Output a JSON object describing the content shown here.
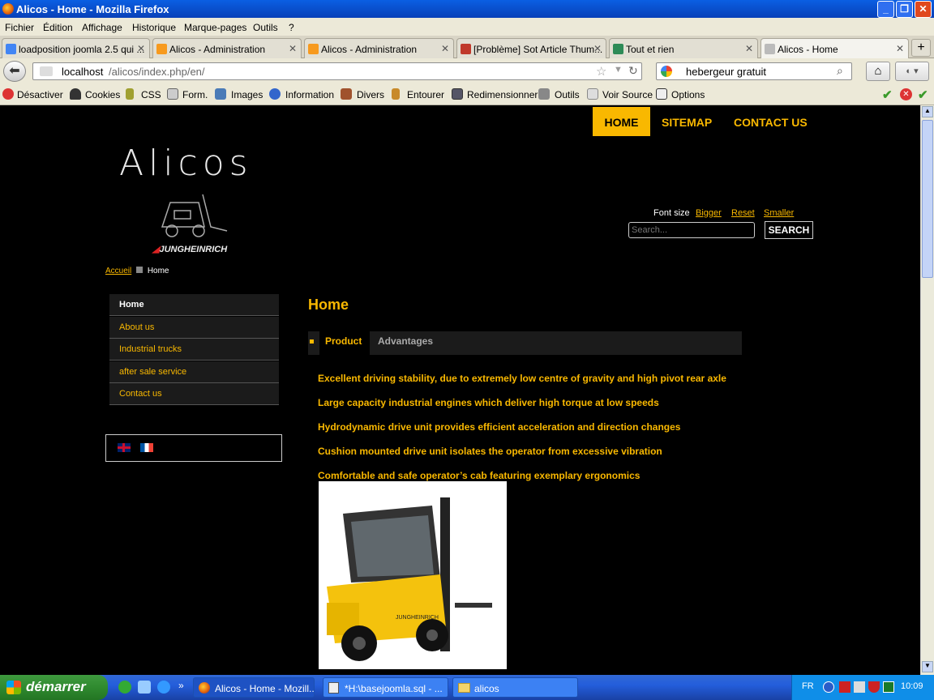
{
  "window": {
    "title": "Alicos - Home - Mozilla Firefox"
  },
  "menubar": [
    "Fichier",
    "Édition",
    "Affichage",
    "Historique",
    "Marque-pages",
    "Outils",
    "?"
  ],
  "tabs": [
    {
      "label": "loadposition joomla 2.5 qui ..."
    },
    {
      "label": "Alicos - Administration"
    },
    {
      "label": "Alicos - Administration"
    },
    {
      "label": "[Problème] Sot Article Thum..."
    },
    {
      "label": "Tout et rien"
    },
    {
      "label": "Alicos - Home"
    }
  ],
  "nav": {
    "url_host": "localhost",
    "url_path": "/alicos/index.php/en/",
    "search_value": "hebergeur gratuit"
  },
  "webdev": [
    "Désactiver",
    "Cookies",
    "CSS",
    "Form.",
    "Images",
    "Information",
    "Divers",
    "Entourer",
    "Redimensionner",
    "Outils",
    "Voir Source",
    "Options"
  ],
  "site": {
    "topnav": [
      "HOME",
      "SITEMAP",
      "CONTACT US"
    ],
    "logo_text": "Alicos",
    "brand": "JUNGHEINRICH",
    "fontsize": {
      "label": "Font size",
      "bigger": "Bigger",
      "reset": "Reset",
      "smaller": "Smaller"
    },
    "search": {
      "placeholder": "Search...",
      "button": "SEARCH"
    },
    "breadcrumb": {
      "home": "Accueil",
      "current": "Home"
    },
    "sidemenu": [
      "Home",
      "About us",
      "Industrial trucks",
      "after sale service",
      "Contact us"
    ],
    "page_title": "Home",
    "content_tabs": [
      "Product",
      "Advantages"
    ],
    "features": [
      "Excellent driving stability, due to extremely low centre of gravity and high pivot rear axle",
      "Large capacity industrial engines which deliver high torque at low speeds",
      "Hydrodynamic drive unit provides efficient acceleration and direction changes",
      "Cushion mounted drive unit isolates the operator from excessive vibration",
      "Comfortable and safe operator’s cab featuring exemplary ergonomics"
    ],
    "truck_label": "JUNGHEINRICH"
  },
  "taskbar": {
    "start": "démarrer",
    "items": [
      "Alicos - Home - Mozill...",
      "*H:\\basejoomla.sql - ...",
      "alicos"
    ],
    "lang": "FR",
    "time": "10:09"
  },
  "colors": {
    "accent": "#f9b800",
    "xp_blue": "#245edb"
  }
}
